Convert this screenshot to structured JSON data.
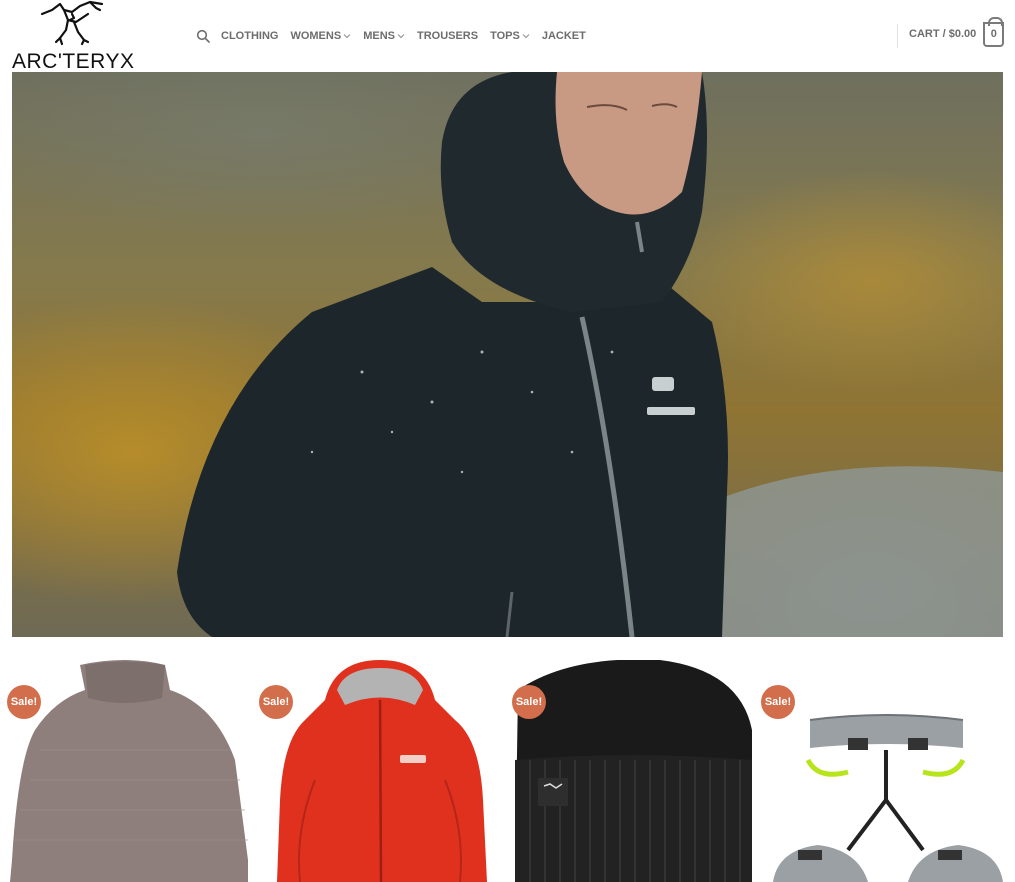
{
  "brand": {
    "name": "ARC'TERYX",
    "logo_icon": "archaeopteryx-icon"
  },
  "nav": {
    "search_icon": "search-icon",
    "items": [
      {
        "label": "CLOTHING",
        "has_dropdown": false
      },
      {
        "label": "WOMENS",
        "has_dropdown": true
      },
      {
        "label": "MENS",
        "has_dropdown": true
      },
      {
        "label": "TROUSERS",
        "has_dropdown": false
      },
      {
        "label": "TOPS",
        "has_dropdown": true
      },
      {
        "label": "JACKET",
        "has_dropdown": false
      }
    ]
  },
  "cart": {
    "label": "CART / $0.00",
    "count": "0"
  },
  "hero": {
    "image": "man in dark hooded rain jacket"
  },
  "products": [
    {
      "badge": "Sale!",
      "image": "knit turtleneck sweater"
    },
    {
      "badge": "Sale!",
      "image": "red hooded shell jacket"
    },
    {
      "badge": "Sale!",
      "image": "black ribbed beanie"
    },
    {
      "badge": "Sale!",
      "image": "climbing harness"
    }
  ],
  "colors": {
    "sale_badge": "#d26e4b",
    "nav_text": "#6d6d6d"
  }
}
